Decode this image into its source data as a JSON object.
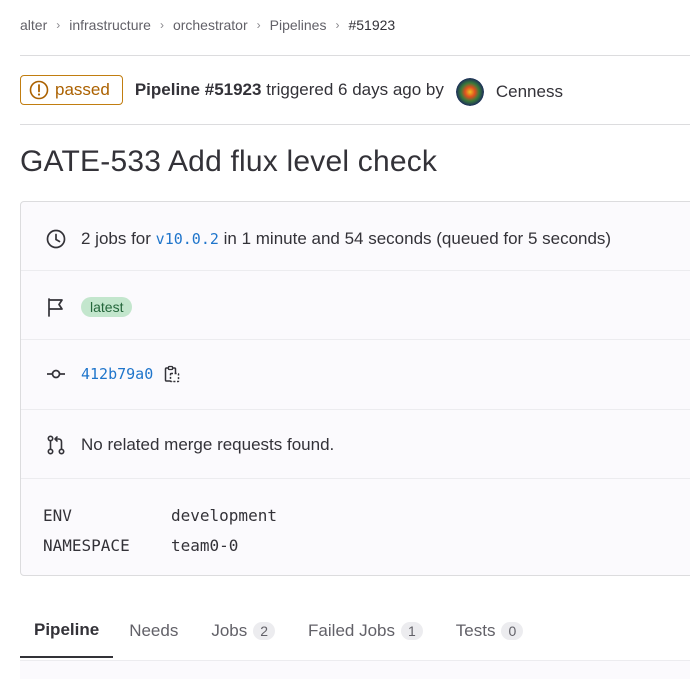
{
  "breadcrumb": [
    "alter",
    "infrastructure",
    "orchestrator",
    "Pipelines",
    "#51923"
  ],
  "header": {
    "status": "passed",
    "pipeline_label": "Pipeline #51923",
    "triggered_text": "triggered 6 days ago by",
    "author": "Cenness"
  },
  "title": "GATE-533 Add flux level check",
  "info": {
    "jobs_prefix": "2 jobs for",
    "ref": "v10.0.2",
    "jobs_suffix": "in 1 minute and 54 seconds (queued for 5 seconds)",
    "tag": "latest",
    "commit": "412b79a0",
    "merge_text": "No related merge requests found.",
    "variables": [
      {
        "key": "ENV",
        "value": "development"
      },
      {
        "key": "NAMESPACE",
        "value": "team0-0"
      }
    ]
  },
  "tabs": [
    {
      "label": "Pipeline",
      "count": null
    },
    {
      "label": "Needs",
      "count": null
    },
    {
      "label": "Jobs",
      "count": "2"
    },
    {
      "label": "Failed Jobs",
      "count": "1"
    },
    {
      "label": "Tests",
      "count": "0"
    }
  ],
  "icons": {
    "status": "passed-status-icon",
    "clock": "clock-icon",
    "flag": "flag-icon",
    "commit": "commit-icon",
    "copy": "copy-to-clipboard-icon",
    "merge": "merge-request-icon"
  },
  "colors": {
    "passed": "#ab6100",
    "link": "#1f75cb",
    "tag_bg": "#c3e6cd"
  }
}
